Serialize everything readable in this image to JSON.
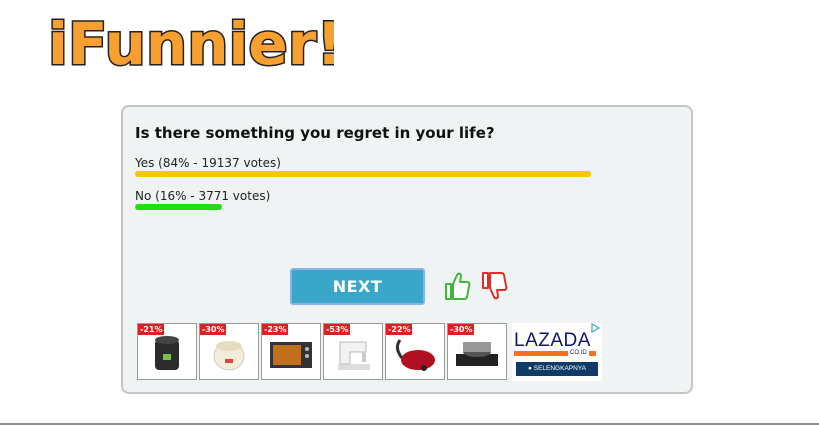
{
  "site": {
    "logo_text": "iFunnier!",
    "logo_fill": "#f7a030",
    "logo_stroke": "#222222"
  },
  "poll": {
    "question": "Is there something you regret in your life?",
    "options": [
      {
        "label": "Yes (84% - 19137 votes)",
        "percent": 84,
        "votes": 19137,
        "color": "#f5c800"
      },
      {
        "label": "No (16% - 3771 votes)",
        "percent": 16,
        "votes": 3771,
        "color": "#22dd11"
      }
    ],
    "next_label": "NEXT",
    "next_color": "#3aa6c9",
    "thumbs_up_icon": "thumbs-up-icon",
    "thumbs_down_icon": "thumbs-down-icon"
  },
  "ad": {
    "products": [
      {
        "discount": "-21%",
        "icon": "rice-cooker-icon"
      },
      {
        "discount": "-30%",
        "icon": "rice-cooker-white-icon"
      },
      {
        "discount": "-23%",
        "icon": "oven-icon"
      },
      {
        "discount": "-53%",
        "icon": "sewing-machine-icon"
      },
      {
        "discount": "-22%",
        "icon": "vacuum-cleaner-icon"
      },
      {
        "discount": "-30%",
        "icon": "stove-icon"
      }
    ],
    "brand": "LAZADA",
    "brand_suffix": "CO.ID",
    "cta": "SELENGKAPNYA",
    "adchoices_icon": "adchoices-icon"
  }
}
